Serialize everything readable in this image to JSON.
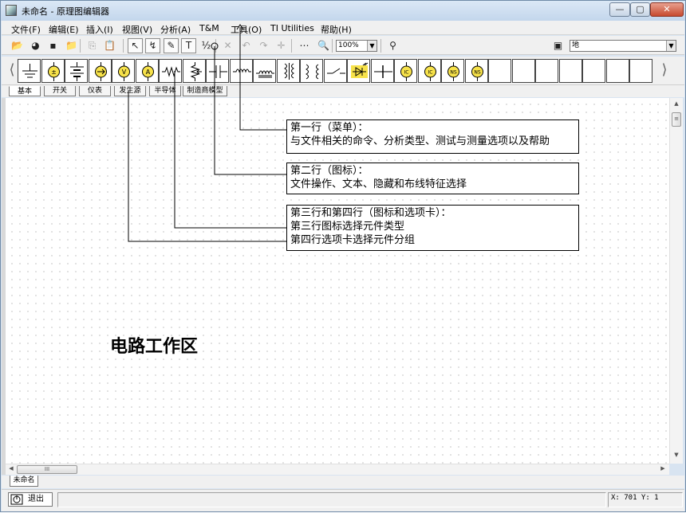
{
  "window": {
    "title": "未命名 - 原理图编辑器",
    "controls": {
      "minimize": "—",
      "maximize": "▢",
      "close": "✕"
    }
  },
  "menu": [
    "文件(F)",
    "编辑(E)",
    "插入(I)",
    "视图(V)",
    "分析(A)",
    "T&M",
    "工具(O)",
    "TI Utilities",
    "帮助(H)"
  ],
  "toolbar": {
    "buttons": [
      {
        "name": "open-icon",
        "glyph": "📂"
      },
      {
        "name": "globe-icon",
        "glyph": "◕"
      },
      {
        "name": "save-icon",
        "glyph": "▪"
      },
      {
        "name": "folder-icon",
        "glyph": "📁"
      },
      {
        "name": "copy-icon",
        "glyph": "⎘"
      },
      {
        "name": "paste-icon",
        "glyph": "📋"
      },
      {
        "name": "select-arrow-icon",
        "glyph": "↖"
      },
      {
        "name": "wire-arrow-icon",
        "glyph": "↯"
      },
      {
        "name": "pen-icon",
        "glyph": "✎"
      },
      {
        "name": "text-icon",
        "glyph": "T"
      },
      {
        "name": "hide-icon",
        "glyph": "½"
      },
      {
        "name": "delete-icon",
        "glyph": "✕"
      },
      {
        "name": "undo-icon",
        "glyph": "↶"
      },
      {
        "name": "redo-icon",
        "glyph": "↷"
      },
      {
        "name": "rotate-icon",
        "glyph": "✛"
      },
      {
        "name": "grid-icon",
        "glyph": "⋯"
      },
      {
        "name": "zoom-icon",
        "glyph": "🔍"
      },
      {
        "name": "probe-icon",
        "glyph": "⚲"
      },
      {
        "name": "subcircuit-icon",
        "glyph": "▣"
      }
    ],
    "zoom_value": "100%",
    "subcircuit_value": "地"
  },
  "palette": {
    "components": [
      "ground-icon",
      "voltage-source-icon",
      "battery-icon",
      "current-source-icon",
      "voltmeter-icon",
      "ammeter-icon",
      "resistor-icon",
      "potentiometer-icon",
      "capacitor-icon",
      "inductor-icon",
      "inductor-core-icon",
      "transformer-icon",
      "transformer-2-icon",
      "switch-icon",
      "led-icon",
      "diode-icon",
      "ic-yellow-icon",
      "ic-probe-icon",
      "ns-icon",
      "ns-probe-icon"
    ],
    "labels": {
      "ic-yellow-icon": "IC",
      "ic-probe-icon": "IC",
      "ns-icon": "NS",
      "ns-probe-icon": "NS",
      "voltmeter-icon": "V",
      "ammeter-icon": "A"
    }
  },
  "tabs": [
    "基本",
    "开关",
    "仪表",
    "发生源",
    "半导体",
    "制造商模型"
  ],
  "callouts": [
    {
      "lines": [
        "第一行（菜单）：",
        "与文件相关的命令、分析类型、测试与测量选项以及帮助"
      ]
    },
    {
      "lines": [
        "第二行（图标）：",
        "文件操作、文本、隐藏和布线特征选择"
      ]
    },
    {
      "lines": [
        "第三行和第四行（图标和选项卡）：",
        "第三行图标选择元件类型",
        "第四行选项卡选择元件分组"
      ]
    }
  ],
  "workspace_label": "电路工作区",
  "scrollbar_thumb": "III",
  "document_tab": "未命名",
  "status": {
    "exit_label": "退出",
    "coords": "X: 701  Y: 1"
  }
}
